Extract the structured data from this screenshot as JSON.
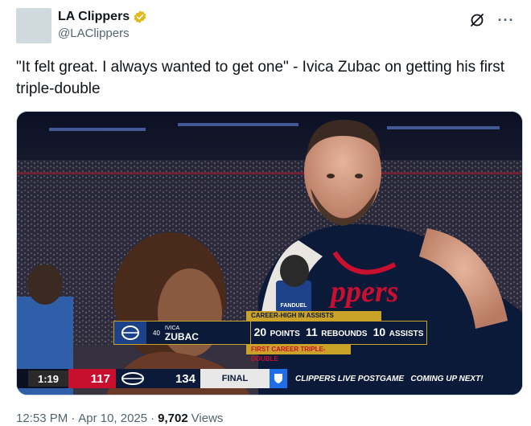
{
  "author": {
    "display_name": "LA Clippers",
    "handle": "@LAClippers",
    "verified_color": "#e2b719"
  },
  "top_icons": [
    "grok-icon",
    "more-icon"
  ],
  "tweet": {
    "text": "\"It felt great. I always wanted to get one\" - Ivica Zubac on getting his first triple-double"
  },
  "broadcast": {
    "stat_header": "CAREER-HIGH IN ASSISTS",
    "jersey_number": "40",
    "first_name": "IVICA",
    "last_name": "ZUBAC",
    "points_value": "20",
    "points_label": "POINTS",
    "rebounds_value": "11",
    "rebounds_label": "REBOUNDS",
    "assists_value": "10",
    "assists_label": "ASSISTS",
    "stat_footer": "FIRST CAREER TRIPLE-DOUBLE",
    "clock": "1:19",
    "away_score": "117",
    "home_score": "134",
    "status": "FINAL",
    "ticker": "CLIPPERS LIVE POSTGAME   COMING UP NEXT!",
    "mic_label": "FANDUEL",
    "jersey_text": "ppers",
    "colors": {
      "accent_gold": "#c9a227",
      "navy": "#0c1a3a",
      "red": "#c8102e",
      "blue": "#1d428a"
    }
  },
  "footer": {
    "time": "12:53 PM",
    "sep1": "·",
    "date": "Apr 10, 2025",
    "sep2": "·",
    "views_count": "9,702",
    "views_label": "Views"
  }
}
